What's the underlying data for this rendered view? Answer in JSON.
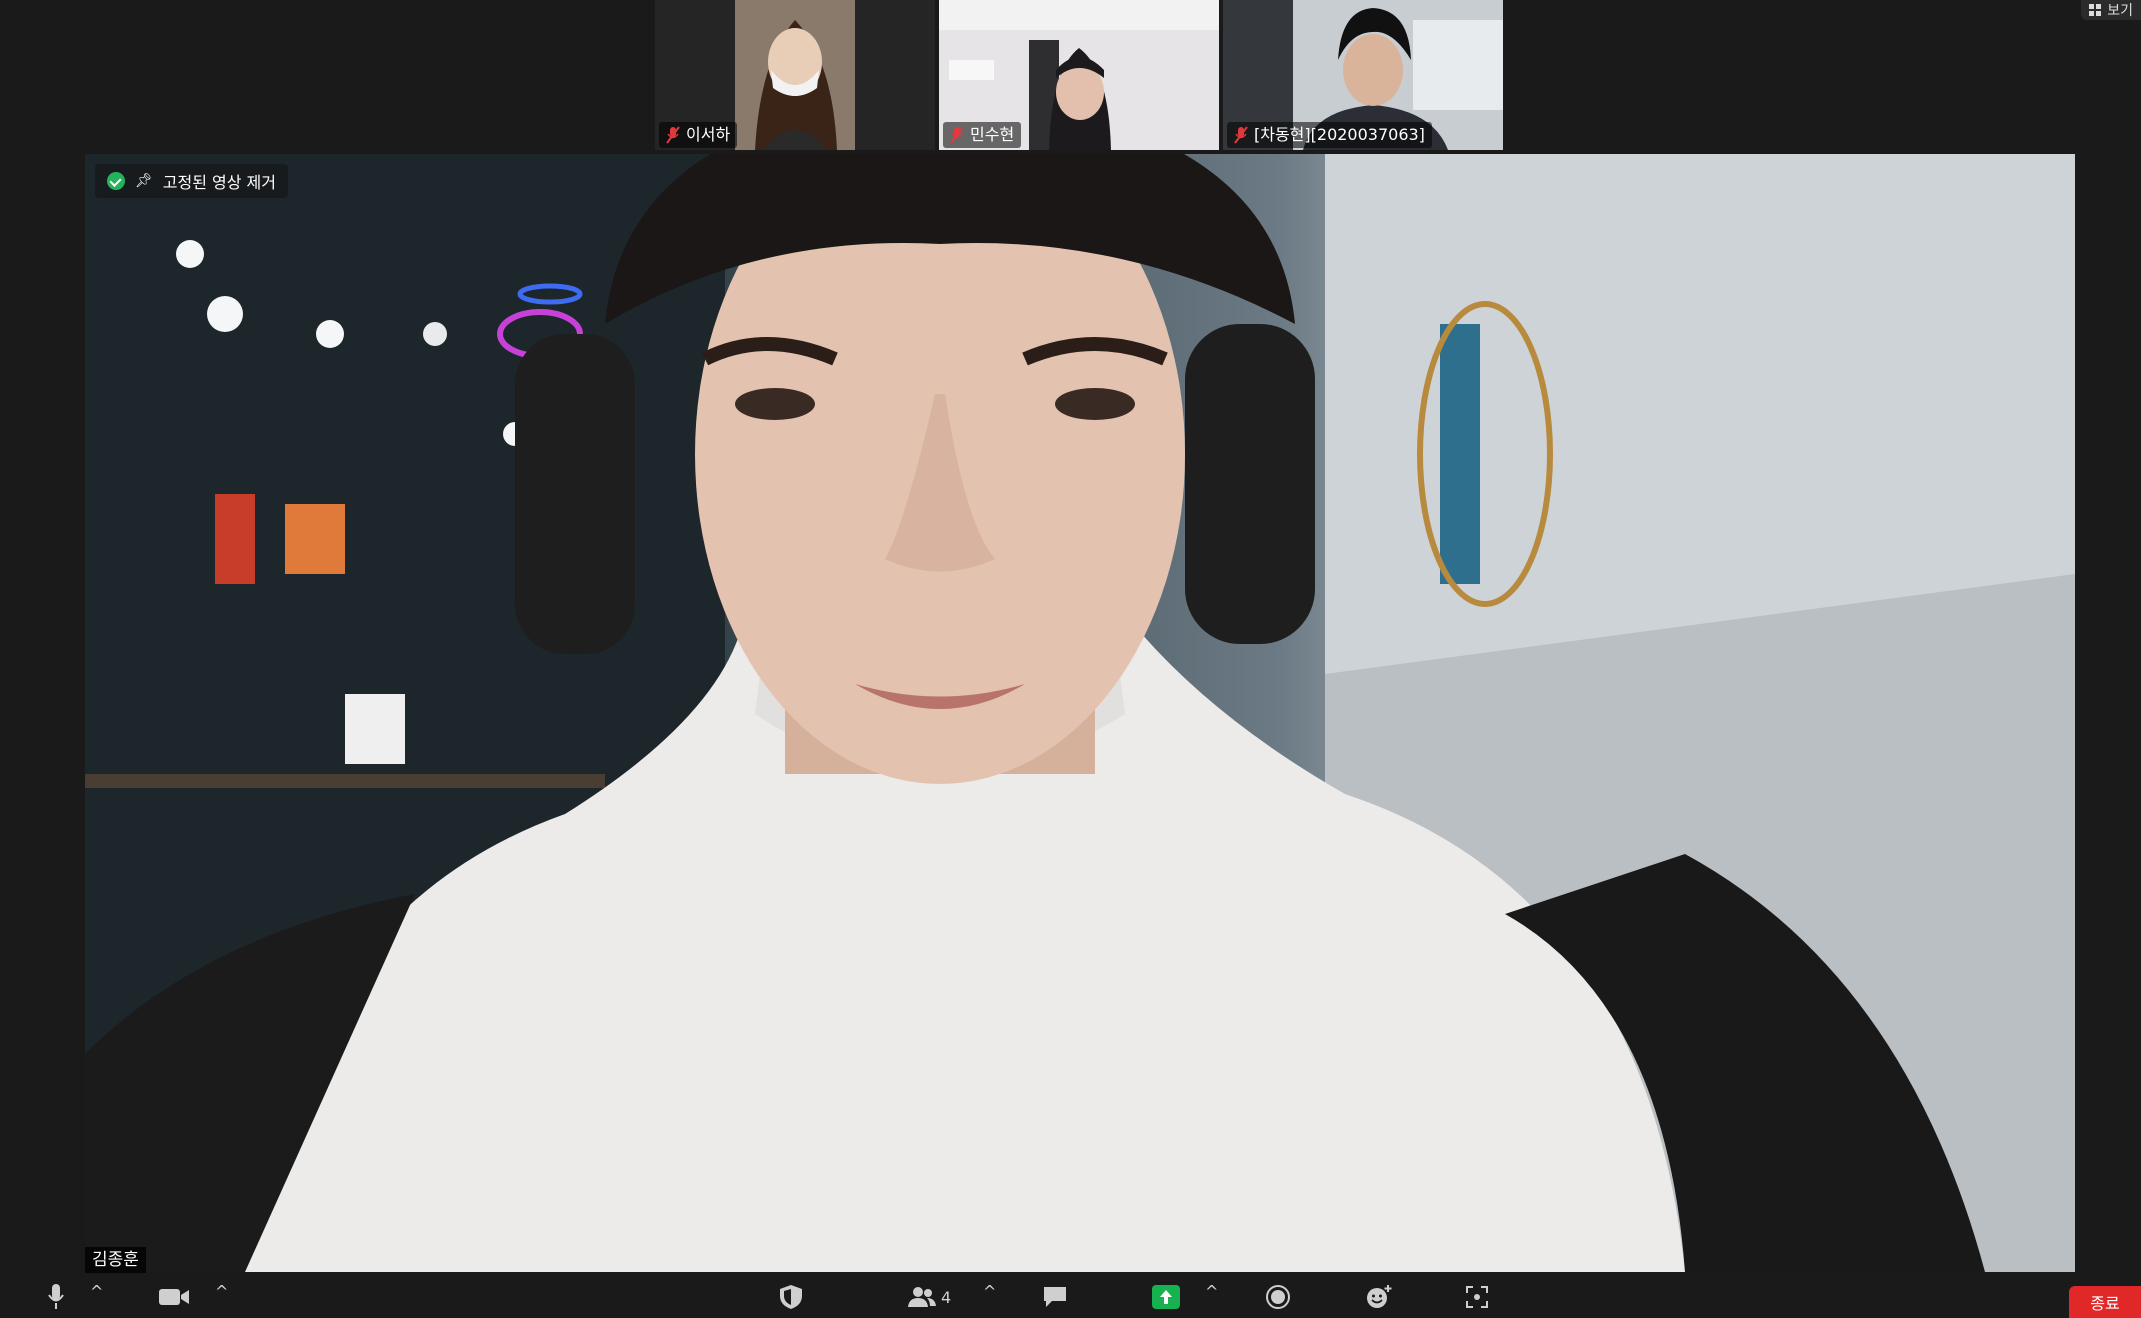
{
  "top_right": {
    "view_label": "보기"
  },
  "participants": [
    {
      "name": "이서하"
    },
    {
      "name": "민수현"
    },
    {
      "name": "[차동현][2020037063]"
    }
  ],
  "main_video": {
    "unpin_label": "고정된 영상 제거",
    "speaker_name": "김종훈"
  },
  "toolbar": {
    "participants_count": "4",
    "end_label": "종료"
  },
  "colors": {
    "background": "#1a1a1a",
    "share_green": "#18b14f",
    "end_red": "#e02828",
    "muted_red": "#e0393e",
    "encrypted_green": "#23b35b"
  },
  "icons": [
    "microphone-icon",
    "video-camera-icon",
    "security-shield-icon",
    "participants-icon",
    "chat-icon",
    "share-screen-icon",
    "record-icon",
    "reactions-icon",
    "apps-icon",
    "muted-mic-icon",
    "pin-icon",
    "encryption-shield-icon",
    "gallery-view-icon"
  ]
}
